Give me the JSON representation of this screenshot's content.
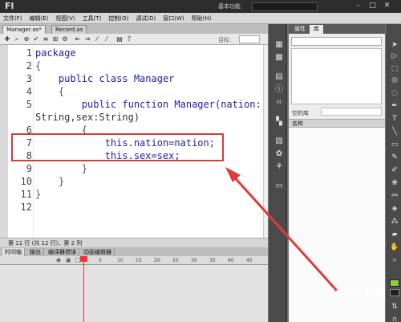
{
  "app": {
    "logo": "Fl",
    "workspace": "基本功能",
    "window_buttons": [
      "–",
      "□",
      "✕"
    ]
  },
  "menu": [
    "文件(F)",
    "编辑(E)",
    "视图(V)",
    "工具(T)",
    "控制(O)",
    "调试(D)",
    "窗口(W)",
    "帮助(H)"
  ],
  "documents": [
    {
      "label": "Manager.as*",
      "active": true
    },
    {
      "label": "Record.as",
      "active": false
    }
  ],
  "toolbar": {
    "icons": [
      "add-script-icon",
      "find-icon",
      "target-icon",
      "check-syntax-icon",
      "auto-format-icon",
      "code-hint-icon",
      "debug-icon",
      "collapse-icon",
      "expand-icon",
      "comment-icon",
      "uncomment-icon",
      "toggle-toolbox-icon",
      "help-icon"
    ],
    "target_label": "目标:"
  },
  "code": {
    "lines": [
      {
        "n": "1",
        "text": "package"
      },
      {
        "n": "2",
        "text": "{"
      },
      {
        "n": "3",
        "text": "    public class Manager"
      },
      {
        "n": "4",
        "text": "    {"
      },
      {
        "n": "5",
        "text": "        public function Manager(nation:"
      },
      {
        "n": "",
        "text": "String,sex:String)"
      },
      {
        "n": "6",
        "text": "        {"
      },
      {
        "n": "7",
        "text": "            this.nation=nation;"
      },
      {
        "n": "8",
        "text": "            this.sex=sex;"
      },
      {
        "n": "9",
        "text": "        }"
      },
      {
        "n": "10",
        "text": "    }"
      },
      {
        "n": "11",
        "text": "}"
      },
      {
        "n": "12",
        "text": ""
      }
    ]
  },
  "status": "第 11 行 (共 12 行)，第 2 列",
  "timeline": {
    "tabs": [
      "时间轴",
      "输出",
      "编译器错误",
      "动画编辑器"
    ],
    "frames": [
      "5",
      "10",
      "15",
      "20",
      "25",
      "30",
      "35",
      "40",
      "45"
    ],
    "current_frame": 1
  },
  "library": {
    "tabs": [
      "属性",
      "库"
    ],
    "active_tab": "库",
    "count_label": "空的库",
    "column_header": "名称"
  },
  "colors": {
    "highlight": "#d83a3a",
    "stroke": "#8ccc3a",
    "fill": "#222222"
  },
  "watermark": {
    "brand": "Baidu 经验",
    "url": "jingyan.baidu.com"
  }
}
